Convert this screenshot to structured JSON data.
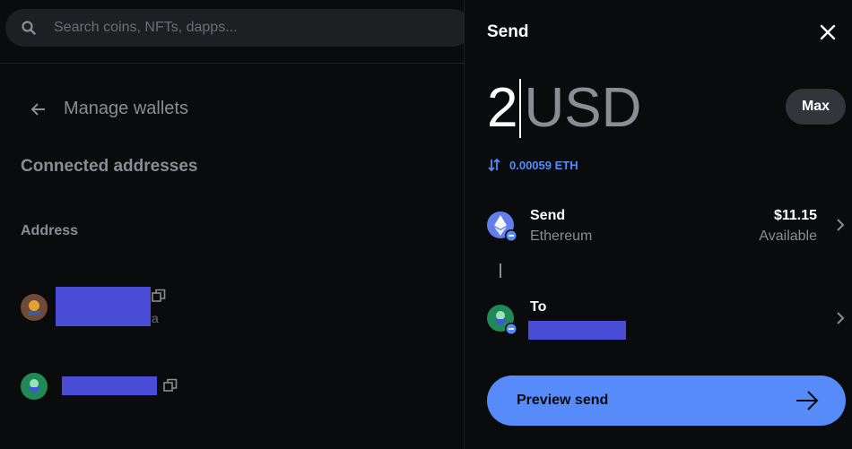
{
  "search": {
    "placeholder": "Search coins, NFTs, dapps..."
  },
  "left": {
    "back_title": "Manage wallets",
    "section_title": "Connected addresses",
    "address_label": "Address",
    "addresses": [
      {
        "avatar": "brown",
        "tail": "a",
        "icon": "copy-icon"
      },
      {
        "avatar": "green",
        "tail": "",
        "icon": "copy-icon"
      }
    ]
  },
  "send": {
    "title": "Send",
    "amount": "2",
    "currency": "USD",
    "max_label": "Max",
    "conversion": "0.00059 ETH",
    "from": {
      "title": "Send",
      "network": "Ethereum",
      "balance": "$11.15",
      "balance_label": "Available"
    },
    "to": {
      "title": "To"
    },
    "preview_label": "Preview send"
  },
  "colors": {
    "accent": "#578bfa",
    "panel_bg": "#0a0b0d",
    "muted": "#8a8d93",
    "redaction": "#4a4bd6"
  }
}
